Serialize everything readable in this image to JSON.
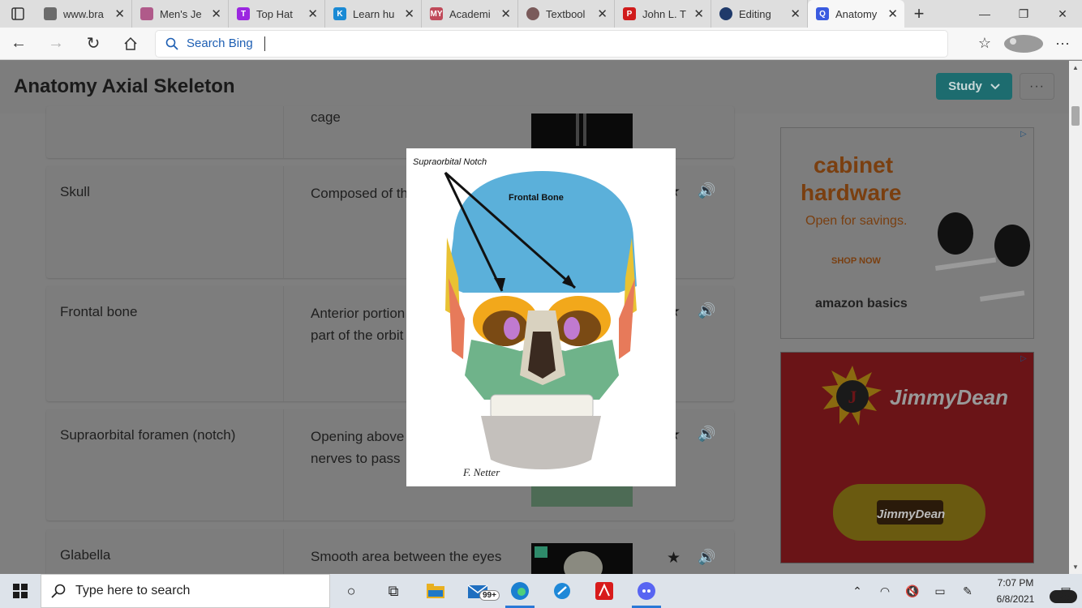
{
  "browser": {
    "tabs": [
      {
        "title": "www.bra",
        "icon": "file-icon",
        "color": "#6b6b6b"
      },
      {
        "title": "Men's Je",
        "icon": "mens-icon",
        "color": "#b05a8a"
      },
      {
        "title": "Top Hat",
        "icon": "tophat-icon",
        "color": "#9b27e0"
      },
      {
        "title": "Learn hu",
        "icon": "k-icon",
        "color": "#1a8ad4"
      },
      {
        "title": "Academi",
        "icon": "my-icon",
        "color": "#c04a5a"
      },
      {
        "title": "Textbool",
        "icon": "textbook-icon",
        "color": "#7a5a5a"
      },
      {
        "title": "John L. T",
        "icon": "pdf-icon",
        "color": "#d01b1b"
      },
      {
        "title": "Editing",
        "icon": "editing-icon",
        "color": "#1f3a6a"
      },
      {
        "title": "Anatomy",
        "icon": "quizlet-icon",
        "color": "#3a5be0"
      }
    ],
    "search_placeholder": "Search Bing"
  },
  "page": {
    "title": "Anatomy Axial Skeleton",
    "study_label": "Study",
    "more_label": "···"
  },
  "cards": [
    {
      "term": "",
      "definition": "cage"
    },
    {
      "term": "Skull",
      "definition": "Composed of th facial bones"
    },
    {
      "term": "Frontal bone",
      "definition": "Anterior portion forms the forehe part of the orbit anterior cranial"
    },
    {
      "term": "Supraorbital foramen (notch)",
      "definition": "Opening above allowing blood nerves to pass"
    },
    {
      "term": "Glabella",
      "definition": "Smooth area between the eyes"
    }
  ],
  "modal": {
    "label_notch": "Supraorbital Notch",
    "label_bone": "Frontal Bone",
    "signature": "F. Netter"
  },
  "ads": {
    "ad1": {
      "line1": "cabinet",
      "line2": "hardware",
      "tagline": "Open for savings.",
      "cta": "SHOP NOW",
      "brand": "amazon basics"
    },
    "ad2": {
      "brand": "JimmyDean",
      "product_brand": "JimmyDean"
    }
  },
  "taskbar": {
    "search_placeholder": "Type here to search",
    "mail_badge": "99+",
    "time": "7:07 PM",
    "date": "6/8/2021",
    "notifications": "25"
  }
}
